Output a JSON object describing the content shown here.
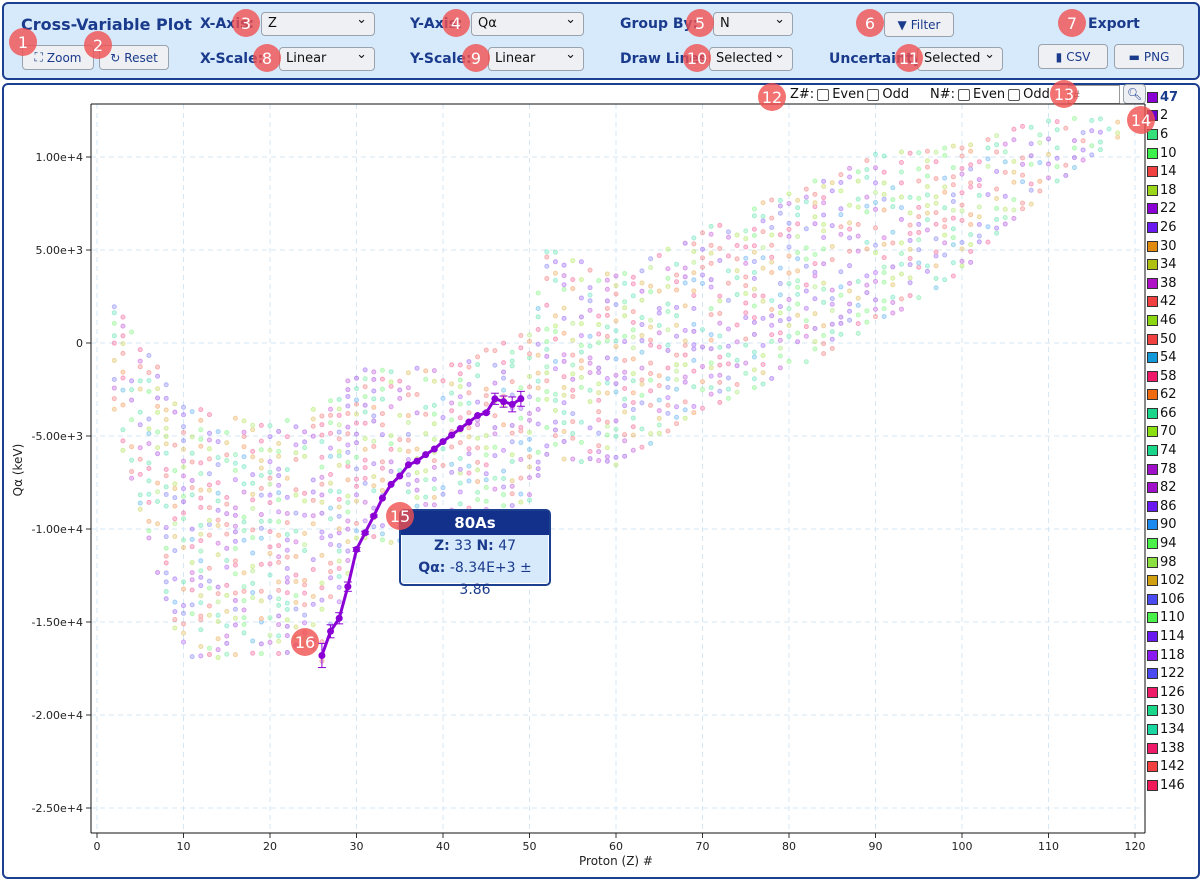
{
  "toolbar": {
    "title": "Cross-Variable Plot",
    "zoom_label": "Zoom",
    "reset_label": "Reset",
    "x_axis_label": "X-Axis:",
    "x_axis_value": "Z",
    "y_axis_label": "Y-Axis:",
    "y_axis_value": "Qα",
    "x_scale_label": "X-Scale:",
    "x_scale_value": "Linear",
    "y_scale_label": "Y-Scale:",
    "y_scale_value": "Linear",
    "group_by_label": "Group By:",
    "group_by_value": "N",
    "draw_lines_label": "Draw Lines:",
    "draw_lines_value": "Selected",
    "uncertainty_label": "Uncertainty:",
    "uncertainty_value": "Selected",
    "filter_label": "Filter",
    "export_label": "Export",
    "csv_label": "CSV",
    "png_label": "PNG"
  },
  "filters": {
    "z_label": "Z#:",
    "n_label": "N#:",
    "even": "Even",
    "odd": "Odd",
    "search_placeholder": "#",
    "z_even": false,
    "z_odd": false,
    "n_even": false,
    "n_odd": false
  },
  "legend": {
    "selected": {
      "label": "47",
      "color": "#8a00d4"
    },
    "items": [
      {
        "label": "2",
        "color": "#6a00d4"
      },
      {
        "label": "6",
        "color": "#33e07a"
      },
      {
        "label": "10",
        "color": "#3df04a"
      },
      {
        "label": "14",
        "color": "#f04040"
      },
      {
        "label": "18",
        "color": "#9ad61a"
      },
      {
        "label": "22",
        "color": "#8a00d4"
      },
      {
        "label": "26",
        "color": "#6a1af0"
      },
      {
        "label": "30",
        "color": "#e08a10"
      },
      {
        "label": "34",
        "color": "#b0c010"
      },
      {
        "label": "38",
        "color": "#b010c8"
      },
      {
        "label": "42",
        "color": "#f04040"
      },
      {
        "label": "46",
        "color": "#8ad610"
      },
      {
        "label": "50",
        "color": "#f04040"
      },
      {
        "label": "54",
        "color": "#1098d8"
      },
      {
        "label": "58",
        "color": "#f01a6a"
      },
      {
        "label": "62",
        "color": "#f06a10"
      },
      {
        "label": "66",
        "color": "#1ad68a"
      },
      {
        "label": "70",
        "color": "#8ae010"
      },
      {
        "label": "74",
        "color": "#1ad68a"
      },
      {
        "label": "78",
        "color": "#a010c8"
      },
      {
        "label": "82",
        "color": "#a010c8"
      },
      {
        "label": "86",
        "color": "#6a1af0"
      },
      {
        "label": "90",
        "color": "#1a8af0"
      },
      {
        "label": "94",
        "color": "#4af04a"
      },
      {
        "label": "98",
        "color": "#8ae040"
      },
      {
        "label": "102",
        "color": "#d0a010"
      },
      {
        "label": "106",
        "color": "#4a4af0"
      },
      {
        "label": "110",
        "color": "#4af04a"
      },
      {
        "label": "114",
        "color": "#6a1af0"
      },
      {
        "label": "118",
        "color": "#8a1af0"
      },
      {
        "label": "122",
        "color": "#4a4af0"
      },
      {
        "label": "126",
        "color": "#f01a6a"
      },
      {
        "label": "130",
        "color": "#1ad68a"
      },
      {
        "label": "134",
        "color": "#1ad6a0"
      },
      {
        "label": "138",
        "color": "#f01a6a"
      },
      {
        "label": "142",
        "color": "#f04040"
      },
      {
        "label": "146",
        "color": "#f01a5a"
      }
    ]
  },
  "tooltip": {
    "title": "80As",
    "z_label": "Z:",
    "z": "33",
    "n_label": "N:",
    "n": "47",
    "q_label": "Qα:",
    "q": "-8.34E+3 ± 3.86"
  },
  "badges": [
    "1",
    "2",
    "3",
    "4",
    "5",
    "6",
    "7",
    "8",
    "9",
    "10",
    "11",
    "12",
    "13",
    "14",
    "15",
    "16"
  ],
  "chart_data": {
    "type": "scatter",
    "xlabel": "Proton (Z) #",
    "ylabel": "Qα (keV)",
    "xlim": [
      -1,
      121
    ],
    "ylim": [
      -27100.0,
      13000.0
    ],
    "xticks": [
      0,
      10,
      20,
      30,
      40,
      50,
      60,
      70,
      80,
      90,
      100,
      110,
      120
    ],
    "xtick_labels": [
      "0",
      "10",
      "20",
      "30",
      "40",
      "50",
      "60",
      "70",
      "80",
      "90",
      "100",
      "110",
      "120"
    ],
    "yticks": [
      10000,
      5000,
      0,
      -5000,
      -10000,
      -15000,
      -20000,
      -25000
    ],
    "ytick_labels": [
      "1.00e+4",
      "5.00e+3",
      "0",
      "-5.00e+3",
      "-1.00e+4",
      "-1.50e+4",
      "-2.00e+4",
      "-2.50e+4"
    ],
    "grid": true,
    "legend_placement": "right",
    "highlighted_series": {
      "name": "47",
      "color": "#8a00d4",
      "x": [
        26,
        27,
        28,
        29,
        30,
        31,
        32,
        33,
        34,
        35,
        36,
        37,
        38,
        39,
        40,
        41,
        42,
        43,
        44,
        45,
        46,
        47,
        48,
        49
      ],
      "y": [
        -16800,
        -15500,
        -14800,
        -13100,
        -11100,
        -10200,
        -9300,
        -8340,
        -7600,
        -7150,
        -6550,
        -6350,
        -6000,
        -5700,
        -5300,
        -4950,
        -4600,
        -4250,
        -3900,
        -3750,
        -3000,
        -3150,
        -3300,
        -3000
      ],
      "err": [
        650,
        350,
        300,
        250,
        100,
        80,
        60,
        4,
        30,
        30,
        30,
        30,
        30,
        30,
        30,
        30,
        30,
        30,
        40,
        60,
        300,
        300,
        400,
        400
      ]
    }
  }
}
